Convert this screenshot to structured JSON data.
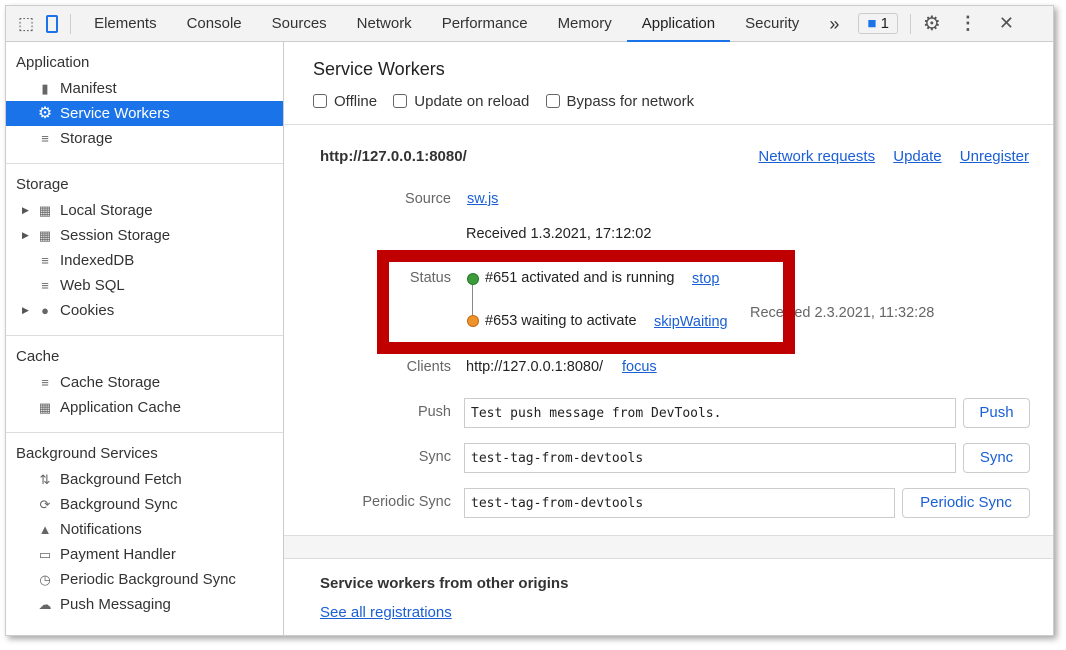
{
  "toolbar": {
    "tabs": [
      "Elements",
      "Console",
      "Sources",
      "Network",
      "Performance",
      "Memory",
      "Application",
      "Security"
    ],
    "active": "Application",
    "more": "»",
    "issues_count": "1"
  },
  "sidebar": {
    "application": {
      "title": "Application",
      "items": [
        "Manifest",
        "Service Workers",
        "Storage"
      ]
    },
    "storage": {
      "title": "Storage",
      "items": [
        "Local Storage",
        "Session Storage",
        "IndexedDB",
        "Web SQL",
        "Cookies"
      ]
    },
    "cache": {
      "title": "Cache",
      "items": [
        "Cache Storage",
        "Application Cache"
      ]
    },
    "bg": {
      "title": "Background Services",
      "items": [
        "Background Fetch",
        "Background Sync",
        "Notifications",
        "Payment Handler",
        "Periodic Background Sync",
        "Push Messaging"
      ]
    }
  },
  "main": {
    "title": "Service Workers",
    "options": [
      "Offline",
      "Update on reload",
      "Bypass for network"
    ],
    "origin": "http://127.0.0.1:8080/",
    "links": [
      "Network requests",
      "Update",
      "Unregister"
    ],
    "source_label": "Source",
    "source_file": "sw.js",
    "received1": "Received 1.3.2021, 17:12:02",
    "status_label": "Status",
    "status1": "#651 activated and is running",
    "stop": "stop",
    "status2": "#653 waiting to activate",
    "skip": "skipWaiting",
    "received2": "Received 2.3.2021, 11:32:28",
    "clients_label": "Clients",
    "clients_url": "http://127.0.0.1:8080/",
    "focus": "focus",
    "push_label": "Push",
    "push_value": "Test push message from DevTools.",
    "push_btn": "Push",
    "sync_label": "Sync",
    "sync_value": "test-tag-from-devtools",
    "sync_btn": "Sync",
    "psync_label": "Periodic Sync",
    "psync_value": "test-tag-from-devtools",
    "psync_btn": "Periodic Sync",
    "other_title": "Service workers from other origins",
    "see_all": "See all registrations"
  },
  "colors": {
    "accent": "#1a73e8",
    "running": "#3c9c3c",
    "waiting": "#f0922b",
    "highlight": "#c00000"
  }
}
